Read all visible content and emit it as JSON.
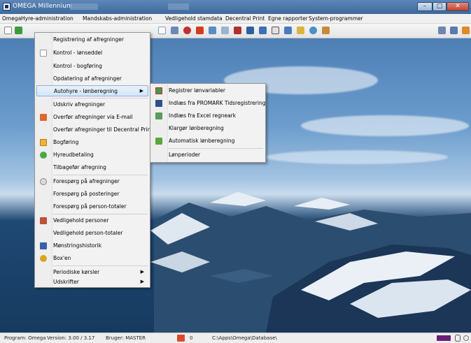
{
  "window": {
    "title": "OMEGA Millennium"
  },
  "menubar": {
    "items": [
      "Omega",
      "Hyre-administration",
      "Mandskabs-administration",
      "Vedligehold stamdata",
      "Decentral Print",
      "Egne rapporter",
      "System-programmer"
    ]
  },
  "main_menu": {
    "items": [
      {
        "label": "Registrering af afregninger",
        "icon": "none"
      },
      {
        "label": "Kontrol - lønseddel",
        "icon": "document-icon"
      },
      {
        "label": "Kontrol - bogføring",
        "icon": "none"
      },
      {
        "label": "Opdatering af afregninger",
        "icon": "none"
      },
      {
        "label": "Autohyre - lønberegning",
        "icon": "none",
        "submenu": true
      },
      {
        "label": "Udskriv afregninger",
        "icon": "none"
      },
      {
        "label": "Overfør afregninger via E-mail",
        "icon": "mail-icon"
      },
      {
        "label": "Overfør afregninger til Decentral Print",
        "icon": "none"
      },
      {
        "label": "Bogføring",
        "icon": "ledger-icon"
      },
      {
        "label": "Hyreudbetaling",
        "icon": "payment-icon"
      },
      {
        "label": "Tilbagefør afregning",
        "icon": "none"
      },
      {
        "label": "Forespørg på afregninger",
        "icon": "search-icon"
      },
      {
        "label": "Forespørg på posteringer",
        "icon": "none"
      },
      {
        "label": "Forespørg på person-totaler",
        "icon": "none"
      },
      {
        "label": "Vedligehold personer",
        "icon": "people-icon"
      },
      {
        "label": "Vedligehold person-totaler",
        "icon": "none"
      },
      {
        "label": "Mønstringshistorik",
        "icon": "history-icon"
      },
      {
        "label": "Box'en",
        "icon": "box-icon"
      },
      {
        "label": "Periodiske kørsler",
        "icon": "none",
        "submenu": true
      },
      {
        "label": "Udskrifter",
        "icon": "none",
        "submenu": true
      }
    ]
  },
  "sub_menu": {
    "items": [
      {
        "label": "Registrer lønvariabler",
        "icon": "register-icon"
      },
      {
        "label": "Indlæs fra PROMARK Tidsregistrering",
        "icon": "import-icon"
      },
      {
        "label": "Indlæs fra Excel regneark",
        "icon": "excel-icon"
      },
      {
        "label": "Klargør lønberegning",
        "icon": "none"
      },
      {
        "label": "Automatisk lønberegning",
        "icon": "calc-icon"
      },
      {
        "label": "Lønperioder",
        "icon": "none"
      }
    ]
  },
  "statusbar": {
    "program": "Program: Omega",
    "version": "Version: 3.00  /  3.17",
    "user": "Bruger: MASTER",
    "count": "0",
    "path": "C:\\Apps\\Omega\\Database\\"
  },
  "colors": {
    "highlight": "#d4e6f8",
    "titlebar": "#3e6a9d",
    "close": "#c0412b"
  }
}
